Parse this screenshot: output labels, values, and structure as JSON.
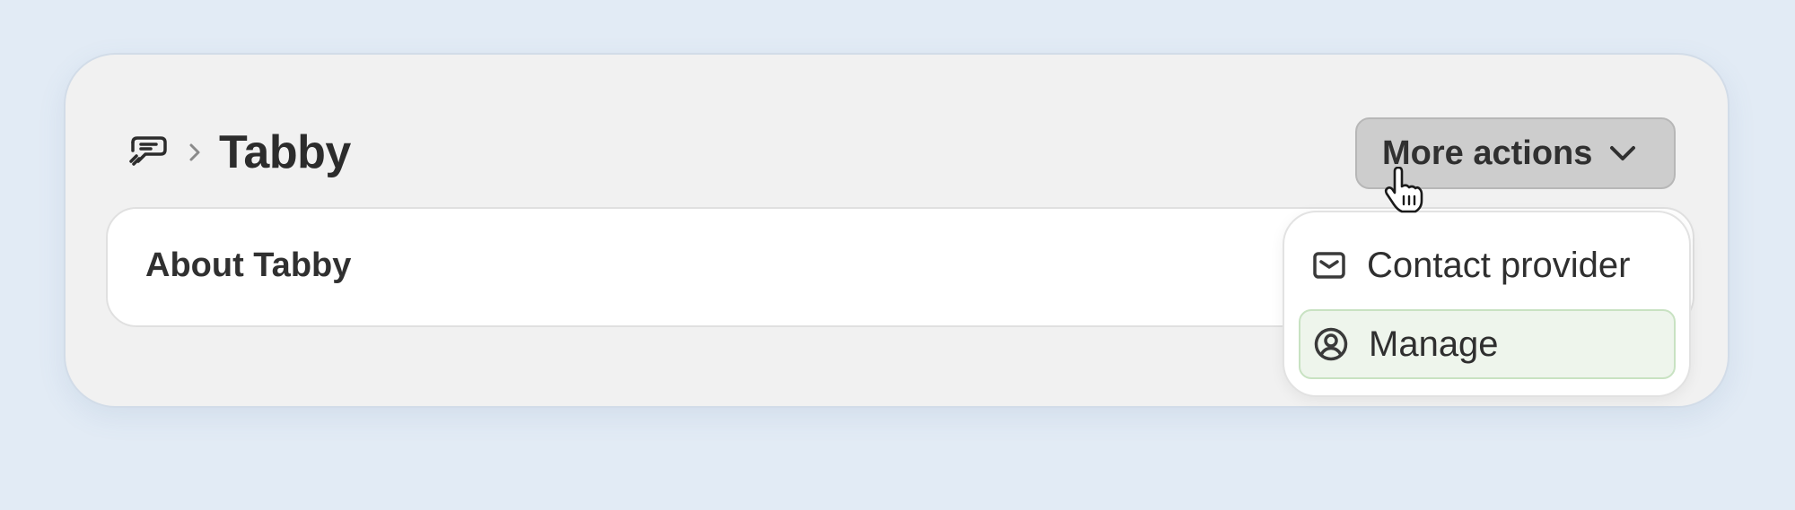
{
  "breadcrumb": {
    "app_icon": "payments-icon",
    "separator_icon": "chevron-right-icon",
    "title": "Tabby"
  },
  "toolbar": {
    "more_actions_label": "More actions",
    "more_actions_icon": "chevron-down-icon"
  },
  "card": {
    "title": "About Tabby"
  },
  "menu": {
    "items": [
      {
        "label": "Contact provider",
        "icon": "envelope-icon",
        "highlighted": false
      },
      {
        "label": "Manage",
        "icon": "user-circle-icon",
        "highlighted": true
      }
    ]
  },
  "cursor": {
    "icon": "hand-pointer-icon"
  },
  "colors": {
    "background": "#e2ebf5",
    "panel": "#f1f1f1",
    "button": "#cdcdcd",
    "highlight": "#eef5ec",
    "highlight_border": "#c8e2c2"
  }
}
